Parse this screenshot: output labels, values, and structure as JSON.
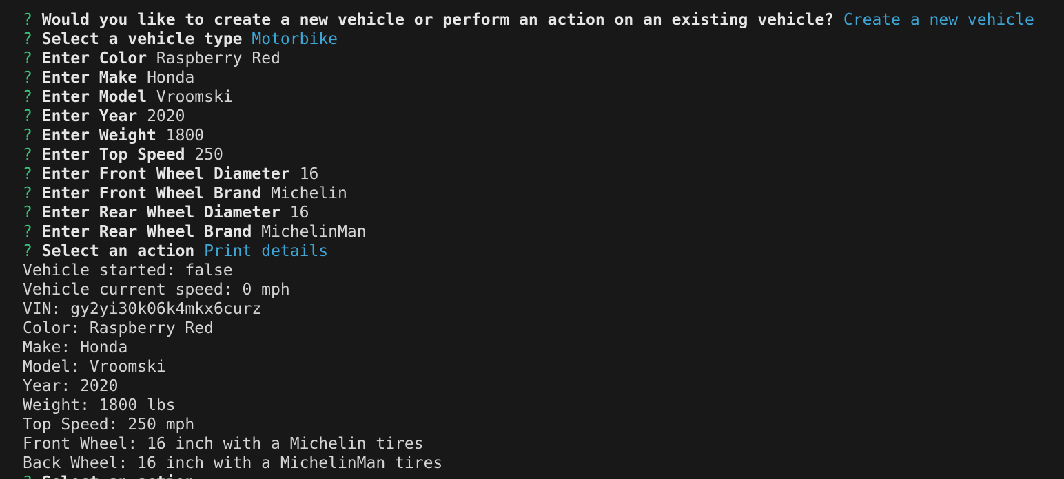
{
  "colors": {
    "background": "#181818",
    "prompt_marker": "#3bc37a",
    "accent_answer": "#3ea6d6",
    "text": "#d4d4d4"
  },
  "prompt_marker": "?",
  "prompts": [
    {
      "question": "Would you like to create a new vehicle or perform an action on an existing vehicle?",
      "answer": "Create a new vehicle",
      "accent": true
    },
    {
      "question": "Select a vehicle type",
      "answer": "Motorbike",
      "accent": true
    },
    {
      "question": "Enter Color",
      "answer": "Raspberry Red",
      "accent": false
    },
    {
      "question": "Enter Make",
      "answer": "Honda",
      "accent": false
    },
    {
      "question": "Enter Model",
      "answer": "Vroomski",
      "accent": false
    },
    {
      "question": "Enter Year",
      "answer": "2020",
      "accent": false
    },
    {
      "question": "Enter Weight",
      "answer": "1800",
      "accent": false
    },
    {
      "question": "Enter Top Speed",
      "answer": "250",
      "accent": false
    },
    {
      "question": "Enter Front Wheel Diameter",
      "answer": "16",
      "accent": false
    },
    {
      "question": "Enter Front Wheel Brand",
      "answer": "Michelin",
      "accent": false
    },
    {
      "question": "Enter Rear Wheel Diameter",
      "answer": "16",
      "accent": false
    },
    {
      "question": "Enter Rear Wheel Brand",
      "answer": "MichelinMan",
      "accent": false
    },
    {
      "question": "Select an action",
      "answer": "Print details",
      "accent": true
    }
  ],
  "output": [
    "Vehicle started: false",
    "Vehicle current speed: 0 mph",
    "VIN: gy2yi30k06k4mkx6curz",
    "Color: Raspberry Red",
    "Make: Honda",
    "Model: Vroomski",
    "Year: 2020",
    "Weight: 1800 lbs",
    "Top Speed: 250 mph",
    "Front Wheel: 16 inch with a Michelin tires",
    "Back Wheel: 16 inch with a MichelinMan tires"
  ],
  "trailing_prompt": {
    "question": "Select an action"
  }
}
